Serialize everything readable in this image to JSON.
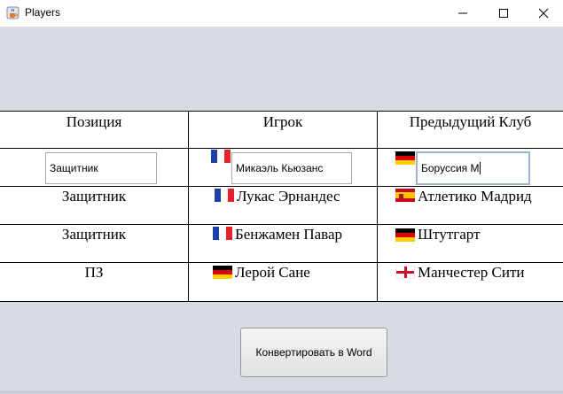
{
  "window": {
    "title": "Players",
    "app_icon": "java-cup-icon",
    "controls": [
      "minimize-icon",
      "maximize-icon",
      "close-icon"
    ]
  },
  "table": {
    "headers": [
      "Позиция",
      "Игрок",
      "Предыдущий Клуб"
    ],
    "edit_row": {
      "position_value": "Защитник",
      "player_flag": "france-flag-icon",
      "player_value": "Микаэль Кьюзанс",
      "club_flag": "germany-flag-icon",
      "club_value": "Боруссия М"
    },
    "rows": [
      {
        "position": "Защитник",
        "player_flag": "france-flag-icon",
        "player": "Лукас Эрнандес",
        "club_flag": "spain-flag-icon",
        "club": "Атлетико Мадрид"
      },
      {
        "position": "Защитник",
        "player_flag": "france-flag-icon",
        "player": "Бенжамен Павар",
        "club_flag": "germany-flag-icon",
        "club": "Штутгарт"
      },
      {
        "position": "ПЗ",
        "player_flag": "germany-flag-icon",
        "player": "Лерой Сане",
        "club_flag": "england-flag-icon",
        "club": "Манчестер Сити"
      }
    ]
  },
  "convert_button": {
    "label": "Конвертировать в Word"
  },
  "colors": {
    "window_bg": "#d8dbe2",
    "focus_border": "#9fb3cf"
  }
}
